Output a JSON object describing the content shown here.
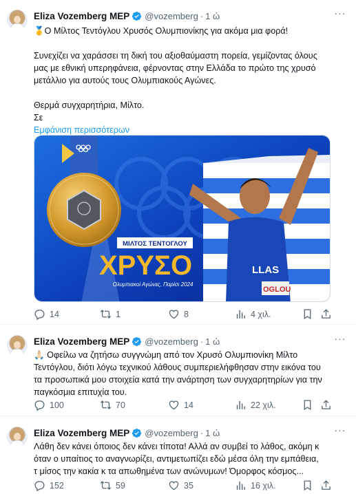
{
  "tweets": [
    {
      "author": "Eliza Vozemberg MEP",
      "handle": "@vozemberg",
      "time": "1 ώ",
      "lines": [
        "🥇Ο Μίλτος Τεντόγλου Χρυσός Ολυμπιονίκης για ακόμα μια φορά!",
        "",
        "Συνεχίζει να χαράσσει τη δική του αξιοθαύμαστη πορεία, γεμίζοντας όλους",
        "μας με εθνική υπερηφάνεια, φέρνοντας στην Ελλάδα το πρώτο της χρυσό",
        "μετάλλιο για αυτούς τους Ολυμπιακούς Αγώνες.",
        "",
        "Θερμά συγχαρητήρια, Μίλτο.",
        "Σε"
      ],
      "show_more": "Εμφάνιση περισσότερων",
      "media": {
        "banner_name": "ΜΙΛΤΟΣ ΤΕΝΤΟΓΛΟΥ",
        "headline": "ΧΡΥΣΟ",
        "caption": "Ολυμπιακοί Αγώνες, Παρίσι 2024",
        "jersey": "LLAS",
        "bib": "OGLOU"
      },
      "stats": {
        "replies": "14",
        "reposts": "1",
        "likes": "8",
        "views": "4 χιλ."
      }
    },
    {
      "author": "Eliza Vozemberg MEP",
      "handle": "@vozemberg",
      "time": "1 ώ",
      "lines": [
        "🙏🏻 Οφείλω να ζητήσω συγγνώμη από τον Χρυσό Ολυμπιονίκη Μίλτο",
        "Τεντόγλου, διότι λόγω τεχνικού λάθους συμπεριελήφθησαν στην εικόνα του",
        "τα προσωπικά μου στοιχεία κατά την ανάρτηση των συγχαρητηρίων για την",
        "παγκόσμια επιτυχία του."
      ],
      "stats": {
        "replies": "100",
        "reposts": "70",
        "likes": "14",
        "views": "22 χιλ."
      }
    },
    {
      "author": "Eliza Vozemberg MEP",
      "handle": "@vozemberg",
      "time": "1 ώ",
      "lines": [
        "Λάθη δεν κάνει όποιος δεν κάνει τίποτα! Αλλά αν συμβεί το λάθος, ακόμη κ",
        "όταν ο υπαίτιος το αναγνωρίζει, αντιμετωπίζει εδώ μέσα όλη την εμπάθεια,",
        "τ μίσος την κακία κ τα απωθημένα των ανώνυμων! Όμορφος κόσμος..."
      ],
      "stats": {
        "replies": "152",
        "reposts": "59",
        "likes": "35",
        "views": "16 χιλ."
      }
    }
  ],
  "colors": {
    "verified": "#1d9bf0",
    "link": "#1d9bf0",
    "muted": "#536471",
    "gold": "#f2b72a",
    "navy": "#0a2a8c"
  },
  "icons": [
    "reply-icon",
    "repost-icon",
    "like-icon",
    "views-icon",
    "bookmark-icon",
    "share-icon",
    "more-icon",
    "verified-icon"
  ]
}
